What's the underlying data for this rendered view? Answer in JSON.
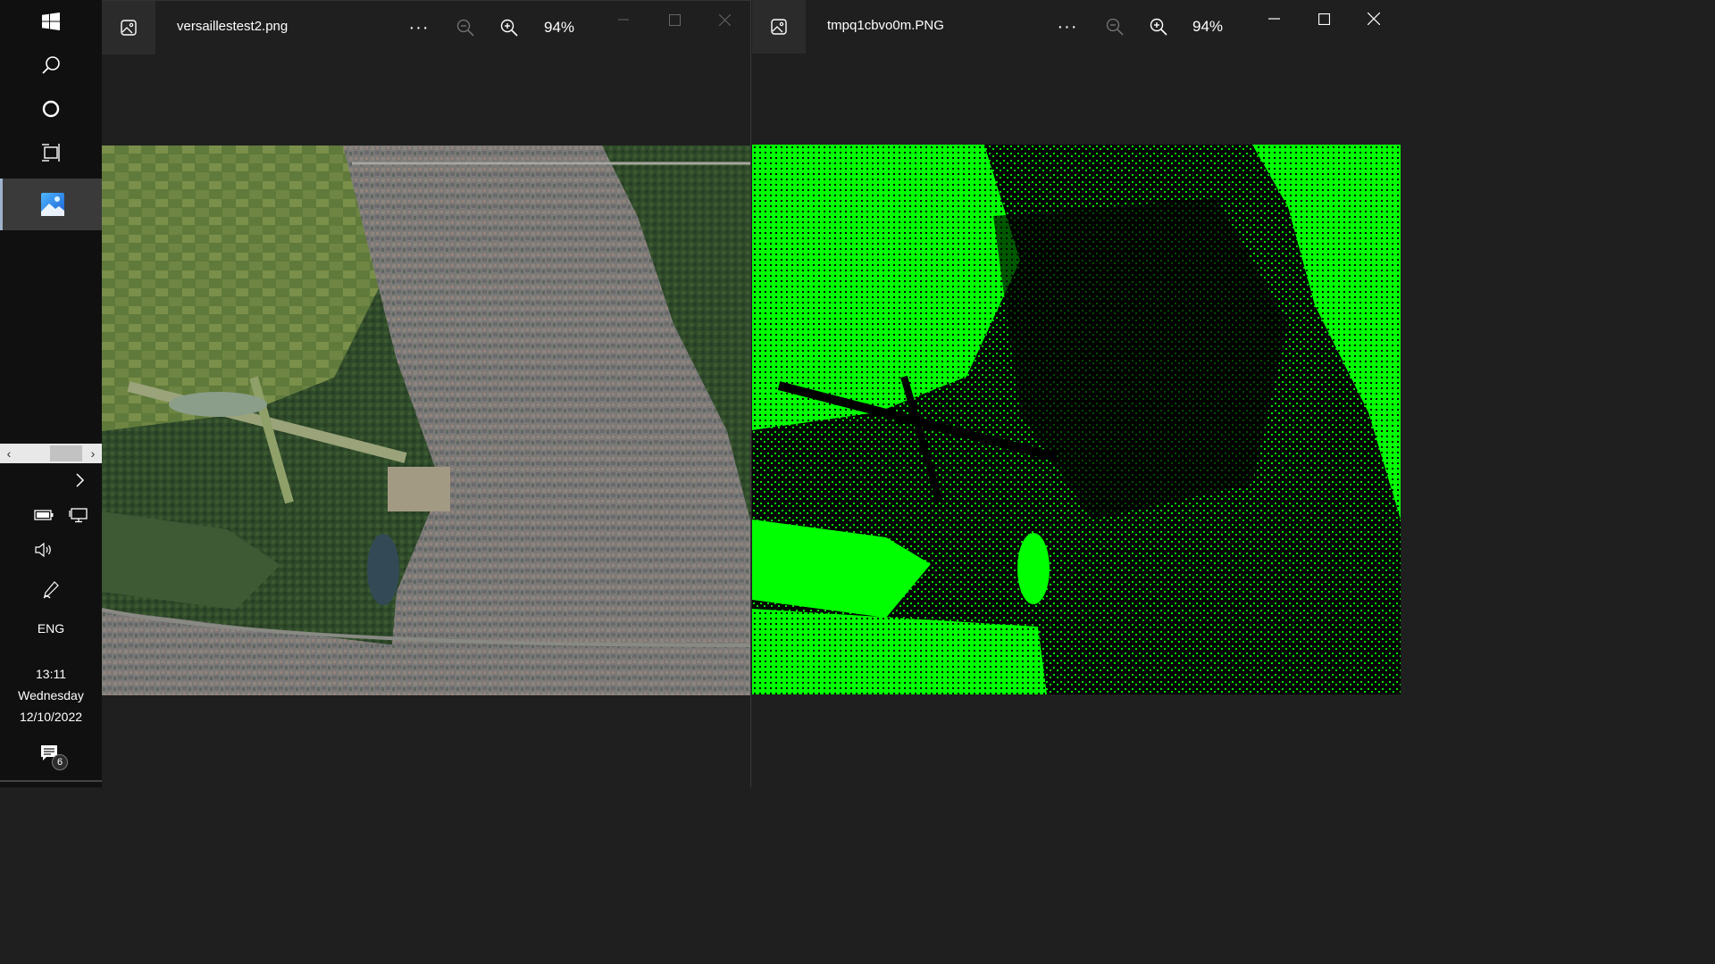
{
  "taskbar": {
    "icons": [
      "windows-logo-icon",
      "search-icon",
      "cortana-icon",
      "task-view-icon",
      "photos-app-icon"
    ],
    "tray_icons": [
      "chevron-right-icon",
      "battery-icon",
      "network-icon",
      "speaker-icon",
      "pen-icon"
    ],
    "language": "ENG",
    "time": "13:11",
    "day": "Wednesday",
    "date": "12/10/2022",
    "notification_count": "6"
  },
  "windows": [
    {
      "filename": "versaillestest2.png",
      "more_label": "···",
      "zoom": "94%",
      "image": "aerial satellite photo of Versailles",
      "active": false
    },
    {
      "filename": "tmpq1cbvo0m.PNG",
      "more_label": "···",
      "zoom": "94%",
      "image": "green vegetation segmentation mask",
      "active": true
    }
  ],
  "colors": {
    "taskbar_bg": "#101010",
    "window_bg": "#1f1f1f",
    "mask_green": "#00ff00",
    "mask_black": "#000000"
  }
}
